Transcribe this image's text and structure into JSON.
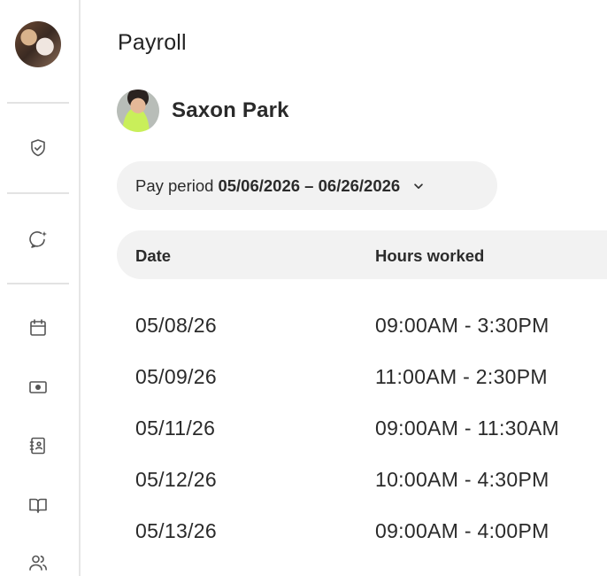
{
  "page": {
    "title": "Payroll"
  },
  "employee": {
    "name": "Saxon Park"
  },
  "pay_period": {
    "label": "Pay period",
    "value": "05/06/2026 – 06/26/2026"
  },
  "table": {
    "columns": [
      "Date",
      "Hours worked"
    ],
    "rows": [
      {
        "date": "05/08/26",
        "hours": "09:00AM - 3:30PM"
      },
      {
        "date": "05/09/26",
        "hours": "11:00AM - 2:30PM"
      },
      {
        "date": "05/11/26",
        "hours": "09:00AM - 11:30AM"
      },
      {
        "date": "05/12/26",
        "hours": "10:00AM - 4:30PM"
      },
      {
        "date": "05/13/26",
        "hours": "09:00AM - 4:00PM"
      }
    ]
  },
  "sidebar": {
    "icons": [
      "shield-check-icon",
      "chat-sparkle-icon",
      "calendar-icon",
      "cash-icon",
      "contacts-book-icon",
      "open-book-icon",
      "people-icon"
    ]
  }
}
